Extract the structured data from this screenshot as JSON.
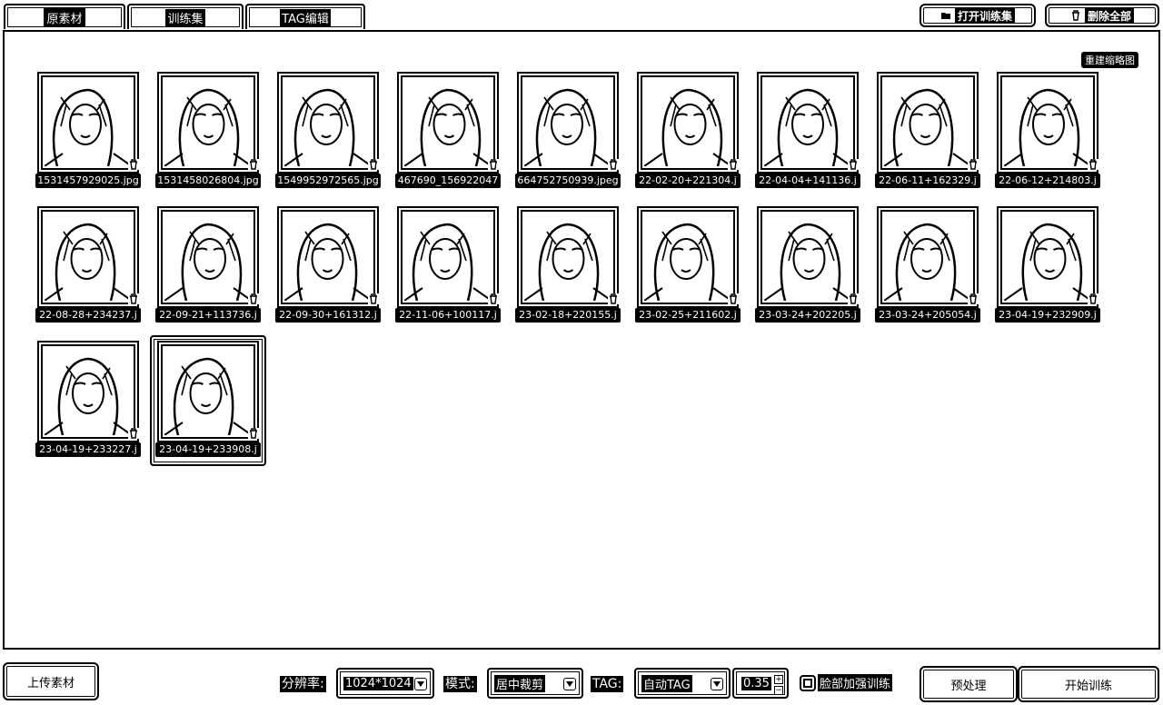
{
  "tabs": [
    {
      "label": "原素材",
      "active": true
    },
    {
      "label": "训练集",
      "active": false
    },
    {
      "label": "TAG编辑",
      "active": false
    }
  ],
  "toolbar": {
    "open_training_set": "打开训练集",
    "delete_all": "删除全部"
  },
  "panel": {
    "rebuild_thumbnails": "重建缩略图"
  },
  "images": [
    "1531457929025.jpg",
    "1531458026804.jpg",
    "1549952972565.jpg",
    "467690_156922047",
    "664752750939.jpeg",
    "22-02-20+221304.j",
    "22-04-04+141136.j",
    "22-06-11+162329.j",
    "22-06-12+214803.j",
    "22-08-28+234237.j",
    "22-09-21+113736.j",
    "22-09-30+161312.j",
    "22-11-06+100117.j",
    "23-02-18+220155.j",
    "23-02-25+211602.j",
    "23-03-24+202205.j",
    "23-03-24+205054.j",
    "23-04-19+232909.j",
    "23-04-19+233227.j",
    "23-04-19+233908.j"
  ],
  "selected_index": 19,
  "bottom": {
    "upload": "上传素材",
    "resolution_label": "分辨率:",
    "resolution_value": "1024*1024",
    "mode_label": "模式:",
    "mode_value": "居中裁剪",
    "tag_label": "TAG:",
    "tag_value": "自动TAG",
    "threshold_value": "0.35",
    "face_boost_label": "脸部加强训练",
    "preprocess": "预处理",
    "start_training": "开始训练"
  }
}
